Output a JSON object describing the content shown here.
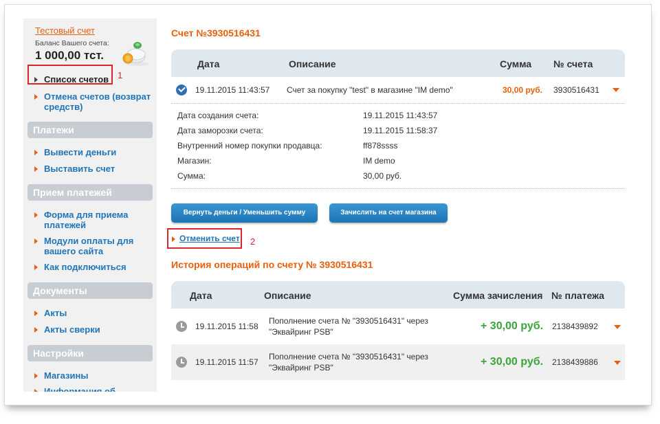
{
  "sidebar": {
    "account_link": "Тестовый счет",
    "balance_label": "Баланс Вашего счета:",
    "balance_value": "1 000,00 тст.",
    "top_items": [
      {
        "label": "Список счетов"
      },
      {
        "label": "Отмена счетов (возврат средств)"
      }
    ],
    "sections": [
      {
        "title": "Платежи",
        "items": [
          "Вывести деньги",
          "Выставить счет"
        ]
      },
      {
        "title": "Прием платежей",
        "items": [
          "Форма для приема платежей",
          "Модули оплаты для вашего сайта",
          "Как подключиться"
        ]
      },
      {
        "title": "Документы",
        "items": [
          "Акты",
          "Акты сверки"
        ]
      },
      {
        "title": "Настройки",
        "items": [
          "Магазины",
          "Информация об"
        ]
      }
    ]
  },
  "annotations": {
    "one": "1",
    "two": "2"
  },
  "invoice": {
    "title": "Счет №3930516431",
    "headers": {
      "date": "Дата",
      "description": "Описание",
      "amount": "Сумма",
      "number": "№ счета"
    },
    "row": {
      "date": "19.11.2015 11:43:57",
      "description": "Счет за покупку \"test\" в магазине \"IM demo\"",
      "amount": "30,00 руб.",
      "number": "3930516431"
    },
    "details": [
      {
        "label": "Дата создания счета:",
        "value": "19.11.2015 11:43:57"
      },
      {
        "label": "Дата заморозки счета:",
        "value": "19.11.2015 11:58:37"
      },
      {
        "label": "Внутренний номер покупки продавца:",
        "value": "ff878ssss"
      },
      {
        "label": "Магазин:",
        "value": "IM demo"
      },
      {
        "label": "Сумма:",
        "value": "30,00 руб."
      }
    ],
    "buttons": {
      "refund": "Вернуть деньги / Уменьшить сумму",
      "credit": "Зачислить на счет магазина"
    },
    "cancel_link": "Отменить счет"
  },
  "history": {
    "title": "История операций по счету № 3930516431",
    "headers": {
      "date": "Дата",
      "description": "Описание",
      "amount": "Сумма зачисления",
      "number": "№ платежа"
    },
    "rows": [
      {
        "date": "19.11.2015 11:58",
        "description_line1": "Пополнение счета № \"3930516431\" через",
        "description_line2": "\"Эквайринг PSB\"",
        "amount": "+ 30,00 руб.",
        "number": "2138439892"
      },
      {
        "date": "19.11.2015 11:57",
        "description_line1": "Пополнение счета № \"3930516431\" через",
        "description_line2": "\"Эквайринг PSB\"",
        "amount": "+ 30,00 руб.",
        "number": "2138439886"
      }
    ]
  },
  "colors": {
    "accent_orange": "#e8600c",
    "link_blue": "#1f75b8",
    "green": "#3aa53a",
    "highlight_red": "#d9262c"
  }
}
